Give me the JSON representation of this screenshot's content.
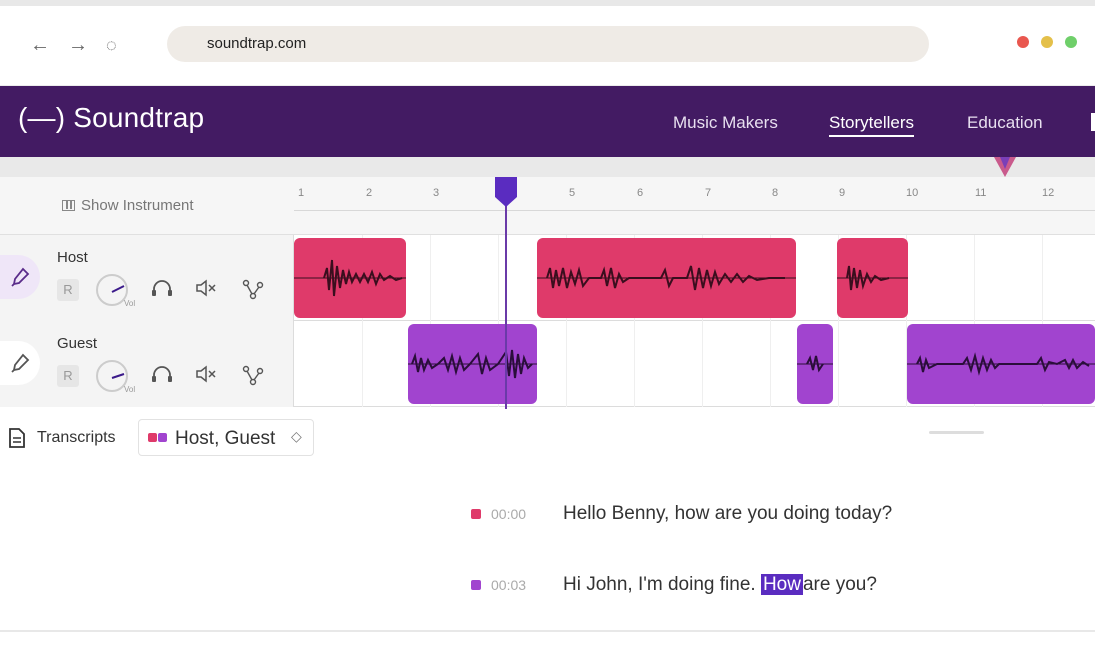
{
  "browser": {
    "url": "soundtrap.com",
    "window_dots": [
      "#e9574f",
      "#e4c04a",
      "#6fcf6a"
    ]
  },
  "header": {
    "logo": "(—) Soundtrap",
    "nav": [
      {
        "label": "Music Makers",
        "active": false
      },
      {
        "label": "Storytellers",
        "active": true
      },
      {
        "label": "Education",
        "active": false
      }
    ],
    "background": "#431b63"
  },
  "timeline": {
    "show_instrument_label": "Show Instrument",
    "ruler_ticks": [
      "1",
      "2",
      "3",
      "4",
      "5",
      "6",
      "7",
      "8",
      "9",
      "10",
      "11",
      "12"
    ],
    "tracks": [
      {
        "name": "Host",
        "record_label": "R",
        "volume_label": "Vol",
        "clip_color": "#df3a6a"
      },
      {
        "name": "Guest",
        "record_label": "R",
        "volume_label": "Vol",
        "clip_color": "#a144cf"
      }
    ]
  },
  "transcripts": {
    "label": "Transcripts",
    "speakers_selected": "Host, Guest",
    "lines": [
      {
        "speaker_color": "#df3a6a",
        "time": "00:00",
        "text": "Hello Benny, how are you doing today?"
      },
      {
        "speaker_color": "#a144cf",
        "time": "00:03",
        "text_before": "Hi John, I'm doing fine.",
        "highlight": "How",
        "text_after": "are you?"
      }
    ]
  }
}
